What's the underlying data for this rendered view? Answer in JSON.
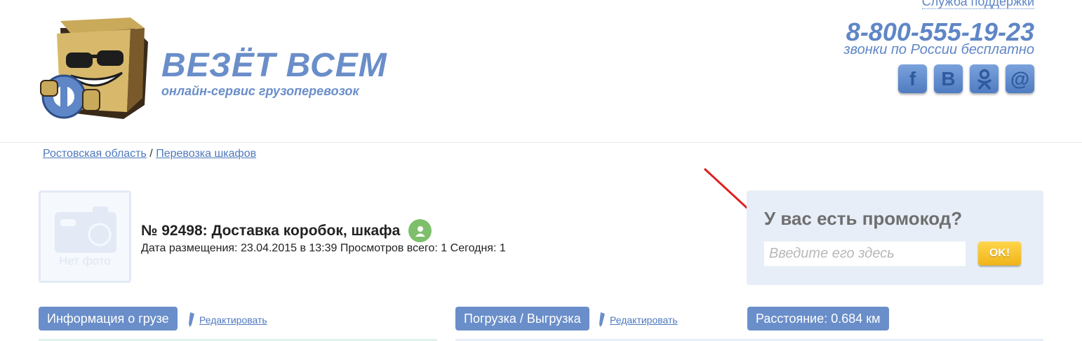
{
  "header": {
    "support_link": "Служба поддержки",
    "brand_title": "ВЕЗЁТ ВСЕМ",
    "brand_subtitle": "онлайн-сервис грузоперевозок",
    "phone": "8-800-555-19-23",
    "phone_note": "звонки по России бесплатно",
    "socials": [
      {
        "icon": "facebook-icon",
        "glyph": "f"
      },
      {
        "icon": "vkontakte-icon",
        "glyph": "B"
      },
      {
        "icon": "odnoklassniki-icon",
        "glyph": "ok"
      },
      {
        "icon": "mail-icon",
        "glyph": "@"
      }
    ]
  },
  "breadcrumb": {
    "items": [
      "Ростовская область",
      "Перевозка шкафов"
    ],
    "separator": "/"
  },
  "order": {
    "photo_placeholder": "Нет фото",
    "title": "№ 92498: Доставка коробок, шкафа",
    "meta": "Дата размещения: 23.04.2015 в 13:39 Просмотров всего: 1 Сегодня: 1"
  },
  "promo": {
    "title": "У вас есть промокод?",
    "input_placeholder": "Введите его здесь",
    "input_value": "",
    "button_label": "OK!"
  },
  "tabs": {
    "cargo_info": "Информация о грузе",
    "loading": "Погрузка / Выгрузка",
    "distance": "Расстояние: 0.684 км",
    "edit_label": "Редактировать"
  },
  "colors": {
    "brand_blue": "#6a8ec9",
    "link_blue": "#4f79bd",
    "promo_bg": "#e8eef7",
    "ok_yellow": "#f0b419",
    "annotation_red": "#e02020"
  }
}
